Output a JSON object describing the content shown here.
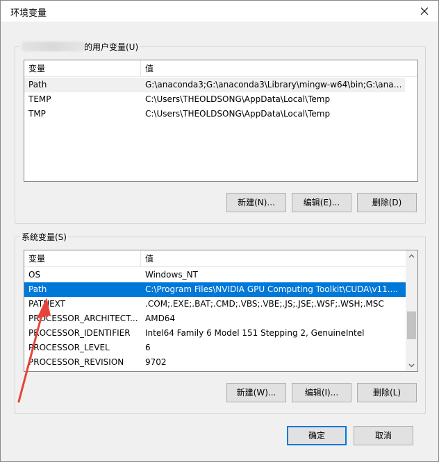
{
  "window": {
    "title": "环境变量",
    "close_label": "×"
  },
  "user_vars": {
    "legend_suffix": "的用户变量(U)",
    "columns": {
      "name": "变量",
      "value": "值"
    },
    "rows": [
      {
        "name": "Path",
        "value": "G:\\anaconda3;G:\\anaconda3\\Library\\mingw-w64\\bin;G:\\anac..."
      },
      {
        "name": "TEMP",
        "value": "C:\\Users\\THEOLDSONG\\AppData\\Local\\Temp"
      },
      {
        "name": "TMP",
        "value": "C:\\Users\\THEOLDSONG\\AppData\\Local\\Temp"
      }
    ],
    "buttons": {
      "new": "新建(N)...",
      "edit": "编辑(E)...",
      "delete": "删除(D)"
    }
  },
  "system_vars": {
    "legend": "系统变量(S)",
    "columns": {
      "name": "变量",
      "value": "值"
    },
    "rows": [
      {
        "name": "OS",
        "value": "Windows_NT"
      },
      {
        "name": "Path",
        "value": "C:\\Program Files\\NVIDIA GPU Computing Toolkit\\CUDA\\v11...."
      },
      {
        "name": "PATHEXT",
        "value": ".COM;.EXE;.BAT;.CMD;.VBS;.VBE;.JS;.JSE;.WSF;.WSH;.MSC"
      },
      {
        "name": "PROCESSOR_ARCHITECT...",
        "value": "AMD64"
      },
      {
        "name": "PROCESSOR_IDENTIFIER",
        "value": "Intel64 Family 6 Model 151 Stepping 2, GenuineIntel"
      },
      {
        "name": "PROCESSOR_LEVEL",
        "value": "6"
      },
      {
        "name": "PROCESSOR_REVISION",
        "value": "9702"
      }
    ],
    "selected_row": 1,
    "buttons": {
      "new": "新建(W)...",
      "edit": "编辑(I)...",
      "delete": "删除(L)"
    }
  },
  "footer": {
    "ok": "确定",
    "cancel": "取消"
  },
  "colors": {
    "selection": "#0078d7",
    "annotation_arrow": "#e8433a"
  }
}
